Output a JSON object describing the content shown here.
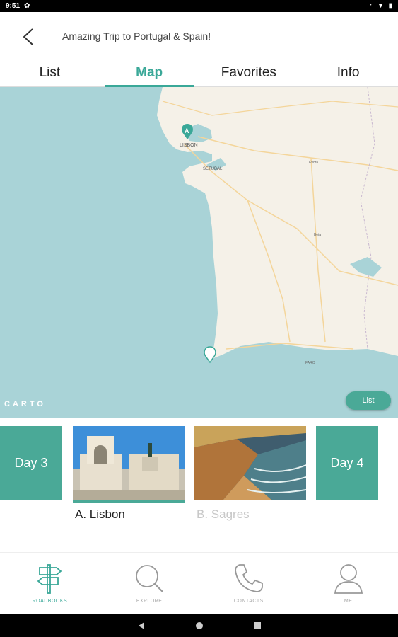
{
  "status_bar": {
    "time": "9:51"
  },
  "header": {
    "title": "Amazing Trip to Portugal & Spain!"
  },
  "tabs": [
    {
      "label": "List",
      "active": false
    },
    {
      "label": "Map",
      "active": true
    },
    {
      "label": "Favorites",
      "active": false
    },
    {
      "label": "Info",
      "active": false
    }
  ],
  "map": {
    "marker_a_letter": "A",
    "labels": {
      "lisbon": "LISBON",
      "setubal": "SETUBAL",
      "evora": "Évora",
      "beja": "Beja",
      "faro": "FARO"
    },
    "attribution": "CARTO",
    "list_button": "List",
    "colors": {
      "sea": "#a9d3d7",
      "land": "#f5f1e8",
      "accent": "#4aa997"
    }
  },
  "carousel": {
    "day_left": "Day 3",
    "day_right": "Day 4",
    "places": [
      {
        "label": "A. Lisbon",
        "selected": true
      },
      {
        "label": "B. Sagres",
        "selected": false
      }
    ]
  },
  "bottom_nav": [
    {
      "label": "ROADBOOKS",
      "icon": "signpost-icon",
      "active": true
    },
    {
      "label": "EXPLORE",
      "icon": "search-icon",
      "active": false
    },
    {
      "label": "CONTACTS",
      "icon": "phone-icon",
      "active": false
    },
    {
      "label": "ME",
      "icon": "user-icon",
      "active": false
    }
  ]
}
